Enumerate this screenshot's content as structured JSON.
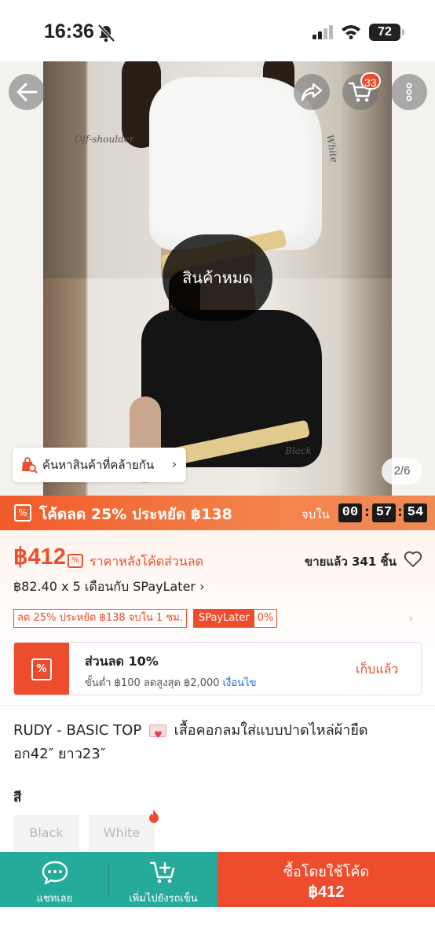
{
  "status_bar": {
    "time": "16:36",
    "battery": "72"
  },
  "gallery": {
    "soldout_label": "สินค้าหมด",
    "similar_label": "ค้นหาสินค้าที่คล้ายกัน",
    "counter": "2/6",
    "cart_count": "33",
    "annotations": {
      "off_shoulder": "Off-shoulder",
      "white": "White",
      "black": "Black"
    }
  },
  "promo": {
    "text": "โค้ดลด 25% ประหยัด ฿138",
    "ends_label": "จบใน",
    "hours": "00",
    "minutes": "57",
    "seconds": "54"
  },
  "price": {
    "amount": "฿412",
    "note": "ราคาหลังโค้ดส่วนลด",
    "sold": "ขายแล้ว 341 ชิ้น",
    "installment": "฿82.40 x 5 เดือนกับ SPayLater",
    "tag_discount": "ลด 25% ประหยัด ฿138 จบใน 1 ชม.",
    "tag_spaylater": "SPayLater",
    "tag_spaylater_pct": "0%"
  },
  "voucher": {
    "title": "ส่วนลด 10%",
    "condition": "ขั้นต่ำ ฿100 ลดสูงสุด ฿2,000",
    "condition_link": "เงื่อนไข",
    "action": "เก็บแล้ว"
  },
  "product": {
    "title_part1": "RUDY - BASIC TOP",
    "title_part2": "เสื้อคอกลมใส่แบบปาดไหล่ผ้ายืด อก42″ ยาว23″"
  },
  "variants": {
    "label": "สี",
    "options": [
      "Black",
      "White"
    ]
  },
  "bottom_bar": {
    "chat_label": "แชทเลย",
    "add_cart_label": "เพิ่มไปยังรถเข็น",
    "buy_line1": "ซื้อโดยใช้โค้ด",
    "buy_line2": "฿412"
  },
  "colors": {
    "brand": "#ee4d2d",
    "teal": "#26aa99"
  }
}
